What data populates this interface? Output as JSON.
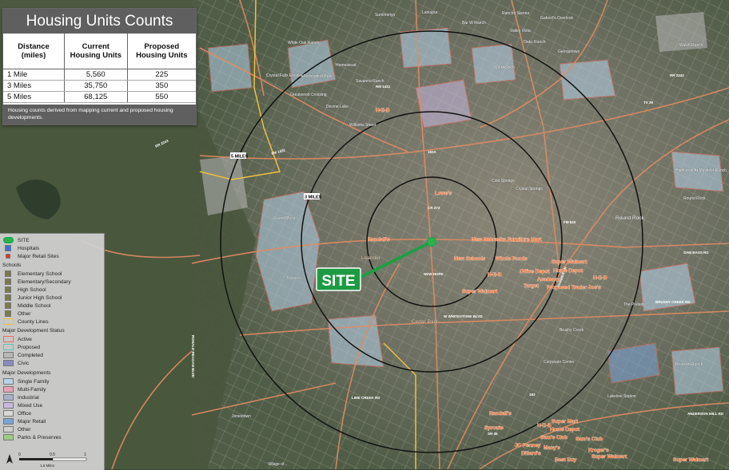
{
  "table": {
    "title": "Housing Units Counts",
    "headers": [
      "Distance (miles)",
      "Current Housing Units",
      "Proposed Housing Units"
    ],
    "rows": [
      [
        "1 Mile",
        "5,560",
        "225"
      ],
      [
        "3 Miles",
        "35,750",
        "350"
      ],
      [
        "5 Miles",
        "68,125",
        "550"
      ]
    ],
    "note": "Housing counts derived from mapping current and proposed housing developments."
  },
  "map": {
    "site_label": "SITE",
    "ring_labels": [
      "5 MILES",
      "3 MILES"
    ],
    "retail_labels": [
      "Lowe's",
      "Randall's",
      "New Nebraska Furniture Mart",
      "New Schools",
      "Whole Foods",
      "Super Walmart",
      "Home Depot",
      "H-E-B",
      "Office Depot",
      "Academy",
      "Target",
      "Proposed Trader Joe's",
      "Super Walmart",
      "H-E-B",
      "Randall's",
      "Sprouts",
      "Super Mart",
      "Home Depot",
      "Sam's Club",
      "Sam's Club",
      "JC Penney",
      "Macy's",
      "Dillard's",
      "Best Buy",
      "Super Walmart",
      "Kroger's",
      "H-E-B",
      "Super Walmart",
      "H-E-B"
    ],
    "place_labels": [
      "Summerlyn",
      "Larkspur",
      "Bar W Ranch",
      "Rancho Sienna",
      "Gabriel's Overlook",
      "Valley Vista",
      "White Oak Ranch",
      "Oaks Ranch",
      "Georgetown",
      "Wolf Ranch",
      "Homestead",
      "Mockingbird Park",
      "Crystal Falls Estates",
      "Savanna Ranch",
      "Greatwood Crossing",
      "Devine Lake",
      "Williams Street",
      "Cedar Park",
      "Leander",
      "Round Rock",
      "Travisso",
      "Grand Mesa",
      "Highlands At Mayfield Ranch",
      "Walsh Ranch",
      "The Presidio",
      "Pearson Ranch",
      "Lakeline Station",
      "Brushy Creek",
      "Corporate Center",
      "Cold Springs",
      "Crystal Springs",
      "Round Rock",
      "Jonestown",
      "Village of..."
    ],
    "road_labels": [
      "RR 2243",
      "FM 1431",
      "RR 2243",
      "183A",
      "183",
      "FM 620",
      "SH 45",
      "TX 29",
      "RM 1431",
      "W WHITESTONE BLVD",
      "PARMER LN",
      "SAM BASS RD",
      "RONALD REAGAN BLVD",
      "BRUSHY CREEK RD",
      "CR 273",
      "NEW HOPE",
      "LIME CREEK RD",
      "ANDERSON MILL RD"
    ]
  },
  "legend": {
    "items_top": [
      {
        "label": "SITE",
        "color": "#2eb14a"
      },
      {
        "label": "Hospitals",
        "color": "#3d6fd6"
      },
      {
        "label": "Major Retail Sites",
        "color": "#e8331c"
      }
    ],
    "schools_head": "Schools",
    "schools": [
      "Elementary School",
      "Elementary/Secondary",
      "High School",
      "Junior High School",
      "Middle School",
      "Other"
    ],
    "county": "County Lines",
    "status_head": "Major Development Status",
    "status": [
      {
        "label": "Active",
        "color": "#f06a5a"
      },
      {
        "label": "Proposed",
        "color": "#56c5b8"
      },
      {
        "label": "Completed",
        "color": "#b8b8b8"
      },
      {
        "label": "Civic",
        "color": "#8a8ac0"
      }
    ],
    "dev_head": "Major Developments",
    "devs": [
      {
        "label": "Single Family",
        "color": "#b6d2e8"
      },
      {
        "label": "Multi-Family",
        "color": "#e8a0b8"
      },
      {
        "label": "Industrial",
        "color": "#a8b0c8"
      },
      {
        "label": "Mixed Use",
        "color": "#c8b8e0"
      },
      {
        "label": "Office",
        "color": "#d8d8d8"
      },
      {
        "label": "Major Retail",
        "color": "#7aa4d8"
      },
      {
        "label": "Other",
        "color": "#cfcfcf"
      },
      {
        "label": "Parks & Preserves",
        "color": "#9ccc84"
      }
    ],
    "scale_ticks": [
      "0",
      "0.5",
      "1"
    ],
    "scale_unit": "1.6 Miles"
  }
}
